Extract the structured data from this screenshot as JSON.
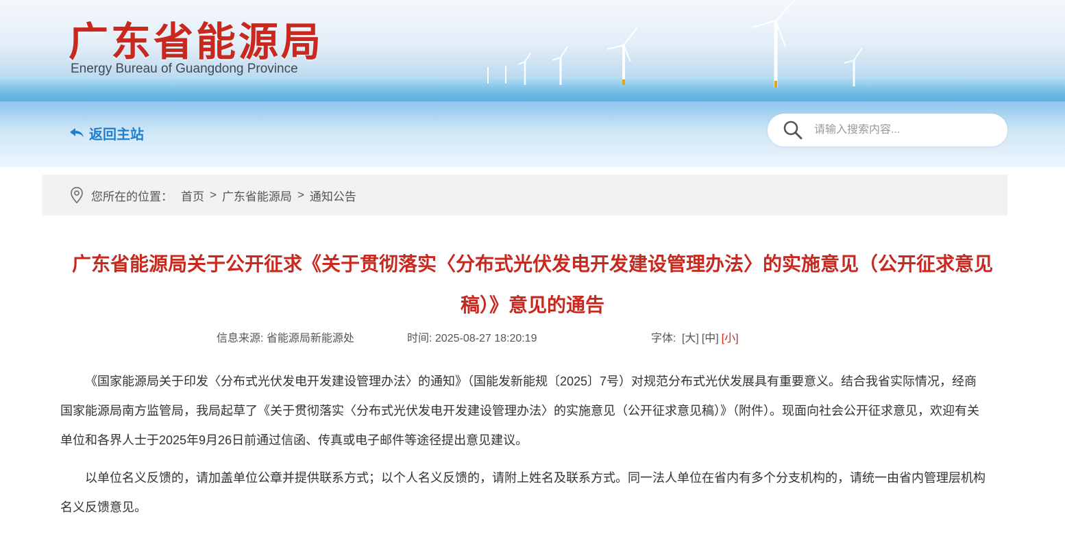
{
  "header": {
    "title": "广东省能源局",
    "subtitle": "Energy Bureau of Guangdong Province"
  },
  "nav": {
    "back_label": "返回主站",
    "search_placeholder": "请输入搜索内容..."
  },
  "breadcrumb": {
    "label": "您所在的位置：",
    "items": [
      "首页",
      "广东省能源局",
      "通知公告"
    ],
    "separator": ">"
  },
  "article": {
    "title": "广东省能源局关于公开征求《关于贯彻落实〈分布式光伏发电开发建设管理办法〉的实施意见（公开征求意见稿）》意见的通告",
    "source_label": "信息来源:",
    "source_value": "省能源局新能源处",
    "time_label": "时间:",
    "time_value": "2025-08-27 18:20:19",
    "font_label": "字体:",
    "font_options": [
      "[大]",
      "[中]",
      "[小]"
    ],
    "active_font": "[小]",
    "paragraphs": [
      "《国家能源局关于印发〈分布式光伏发电开发建设管理办法〉的通知》（国能发新能规〔2025〕7号）对规范分布式光伏发展具有重要意义。结合我省实际情况，经商国家能源局南方监管局，我局起草了《关于贯彻落实〈分布式光伏发电开发建设管理办法〉的实施意见（公开征求意见稿）》（附件）。现面向社会公开征求意见，欢迎有关单位和各界人士于2025年9月26日前通过信函、传真或电子邮件等途径提出意见建议。",
      "以单位名义反馈的，请加盖单位公章并提供联系方式；以个人名义反馈的，请附上姓名及联系方式。同一法人单位在省内有多个分支机构的，请统一由省内管理层机构名义反馈意见。"
    ]
  },
  "colors": {
    "brand_red": "#c8281e",
    "link_blue": "#1e7fd0",
    "breadcrumb_bg": "#f2f2f2"
  },
  "icons": {
    "back": "back-arrow-icon",
    "search": "search-icon",
    "location": "location-pin-icon"
  }
}
